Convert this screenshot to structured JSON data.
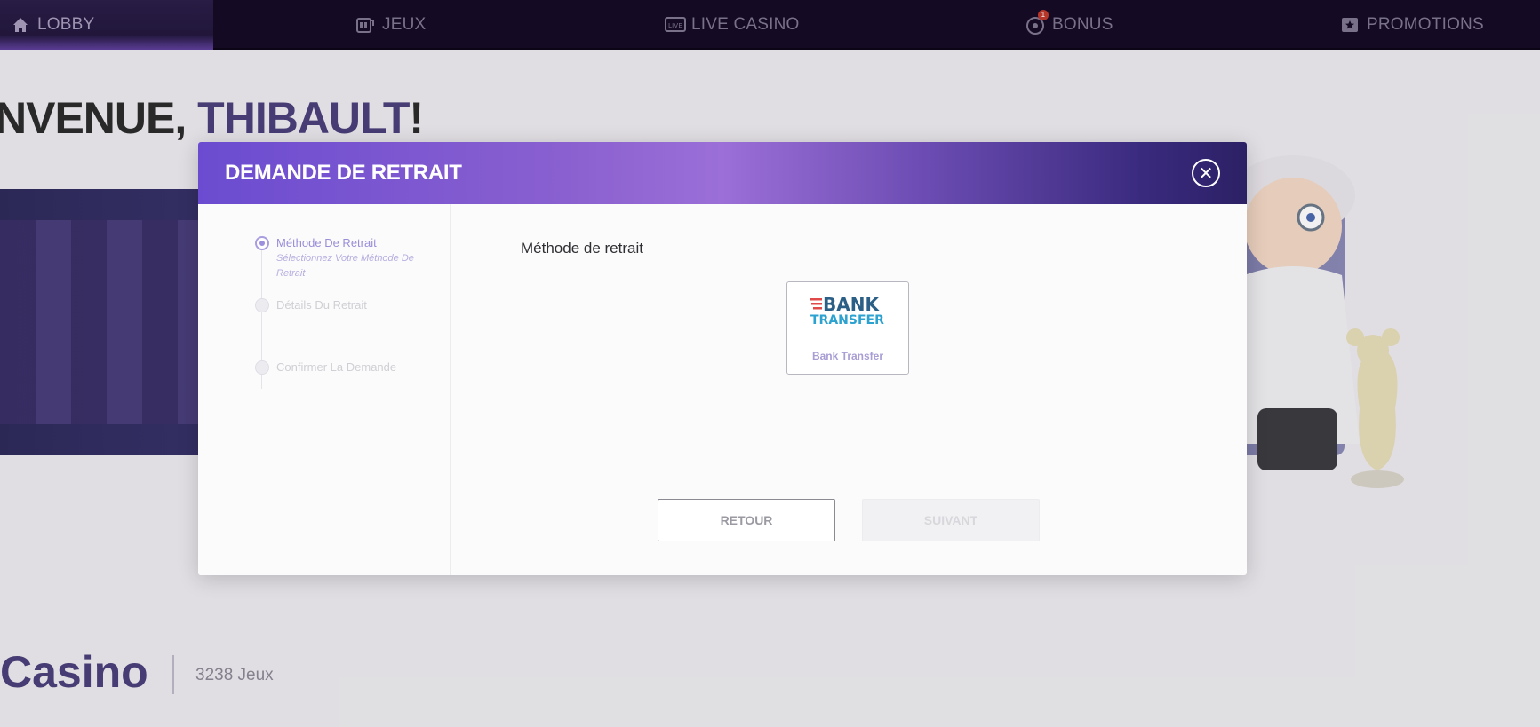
{
  "nav": {
    "items": [
      {
        "label": "LOBBY",
        "icon": "home-icon"
      },
      {
        "label": "JEUX",
        "icon": "slot-machine-icon"
      },
      {
        "label": "LIVE CASINO",
        "icon": "live-icon"
      },
      {
        "label": "BONUS",
        "icon": "bonus-icon",
        "badge": "1"
      },
      {
        "label": "PROMOTIONS",
        "icon": "gift-icon"
      }
    ]
  },
  "page": {
    "welcome_prefix": "NVENUE, ",
    "welcome_name": "THIBAULT",
    "welcome_suffix": "!",
    "casino_title": "Casino",
    "casino_count": "3238 Jeux"
  },
  "modal": {
    "title": "DEMANDE DE RETRAIT",
    "close_symbol": "✕",
    "steps": [
      {
        "label": "Méthode De Retrait",
        "sub": "Sélectionnez Votre Méthode De Retrait",
        "state": "active"
      },
      {
        "label": "Détails Du Retrait",
        "state": "inactive"
      },
      {
        "label": "Confirmer La Demande",
        "state": "inactive"
      }
    ],
    "method_heading": "Méthode de retrait",
    "method": {
      "logo_line1": "BANK",
      "logo_line2": "TRANSFER",
      "label": "Bank Transfer"
    },
    "buttons": {
      "back": "RETOUR",
      "next": "SUIVANT"
    }
  },
  "colors": {
    "accent": "#6b4cd0",
    "nav_bg": "#140a25",
    "welcome_name": "#4a3f7a"
  }
}
